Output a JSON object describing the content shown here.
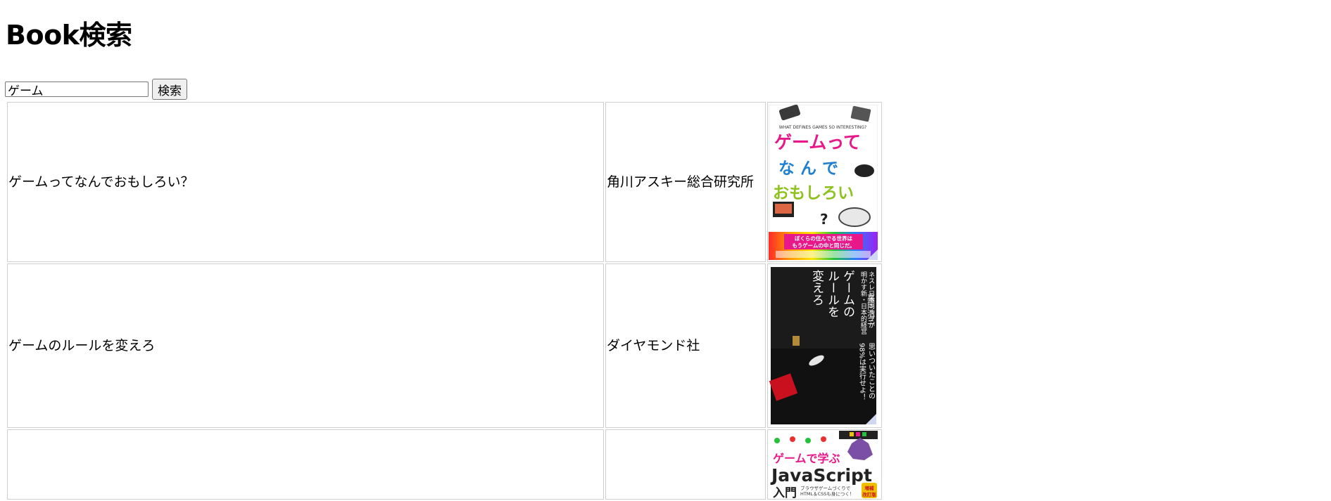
{
  "page": {
    "title": "Book検索"
  },
  "search": {
    "value": "ゲーム",
    "button_label": "検索"
  },
  "results": [
    {
      "title": "ゲームってなんでおもしろい？",
      "publisher": "角川アスキー総合研究所",
      "cover": {
        "top_text": "WHAT DEFINES GAMES SO INTERESTING?",
        "line1": "ゲームって",
        "line2": "な ん で",
        "line3": "おもしろい",
        "mark": "?",
        "band_line1": "ぼくらの住んでる世界は",
        "band_line2": "もうゲームの中と同じだ。"
      }
    },
    {
      "title": "ゲームのルールを変えろ",
      "publisher": "ダイヤモンド社",
      "cover": {
        "subtitle_col1": "ネスレ日本トップが",
        "subtitle_col2": "明かす新・日本的経営",
        "title_col1": "ゲームの",
        "title_col2": "ルールを",
        "title_col3": "変えろ",
        "author": "高岡浩三",
        "catch_col1": "思いついたことの",
        "catch_col2": "98%は実行せよ！"
      }
    },
    {
      "title": "",
      "publisher": "",
      "cover": {
        "line1": "ゲームで学ぶ",
        "line2": "JavaScript",
        "line3": "入門",
        "small1": "ブラウザゲームづくりで",
        "small2": "HTML＆CSSも身につく！",
        "badge1": "増補",
        "badge2": "改訂版"
      }
    }
  ],
  "colors": {
    "cover1_pink": "#e8178a",
    "cover1_blue": "#1f7fd1",
    "cover1_green": "#8dc21f",
    "cover2_bg": "#1b1b1b",
    "cover3_pink": "#e8178a",
    "cover3_purple": "#7b4fa6"
  }
}
